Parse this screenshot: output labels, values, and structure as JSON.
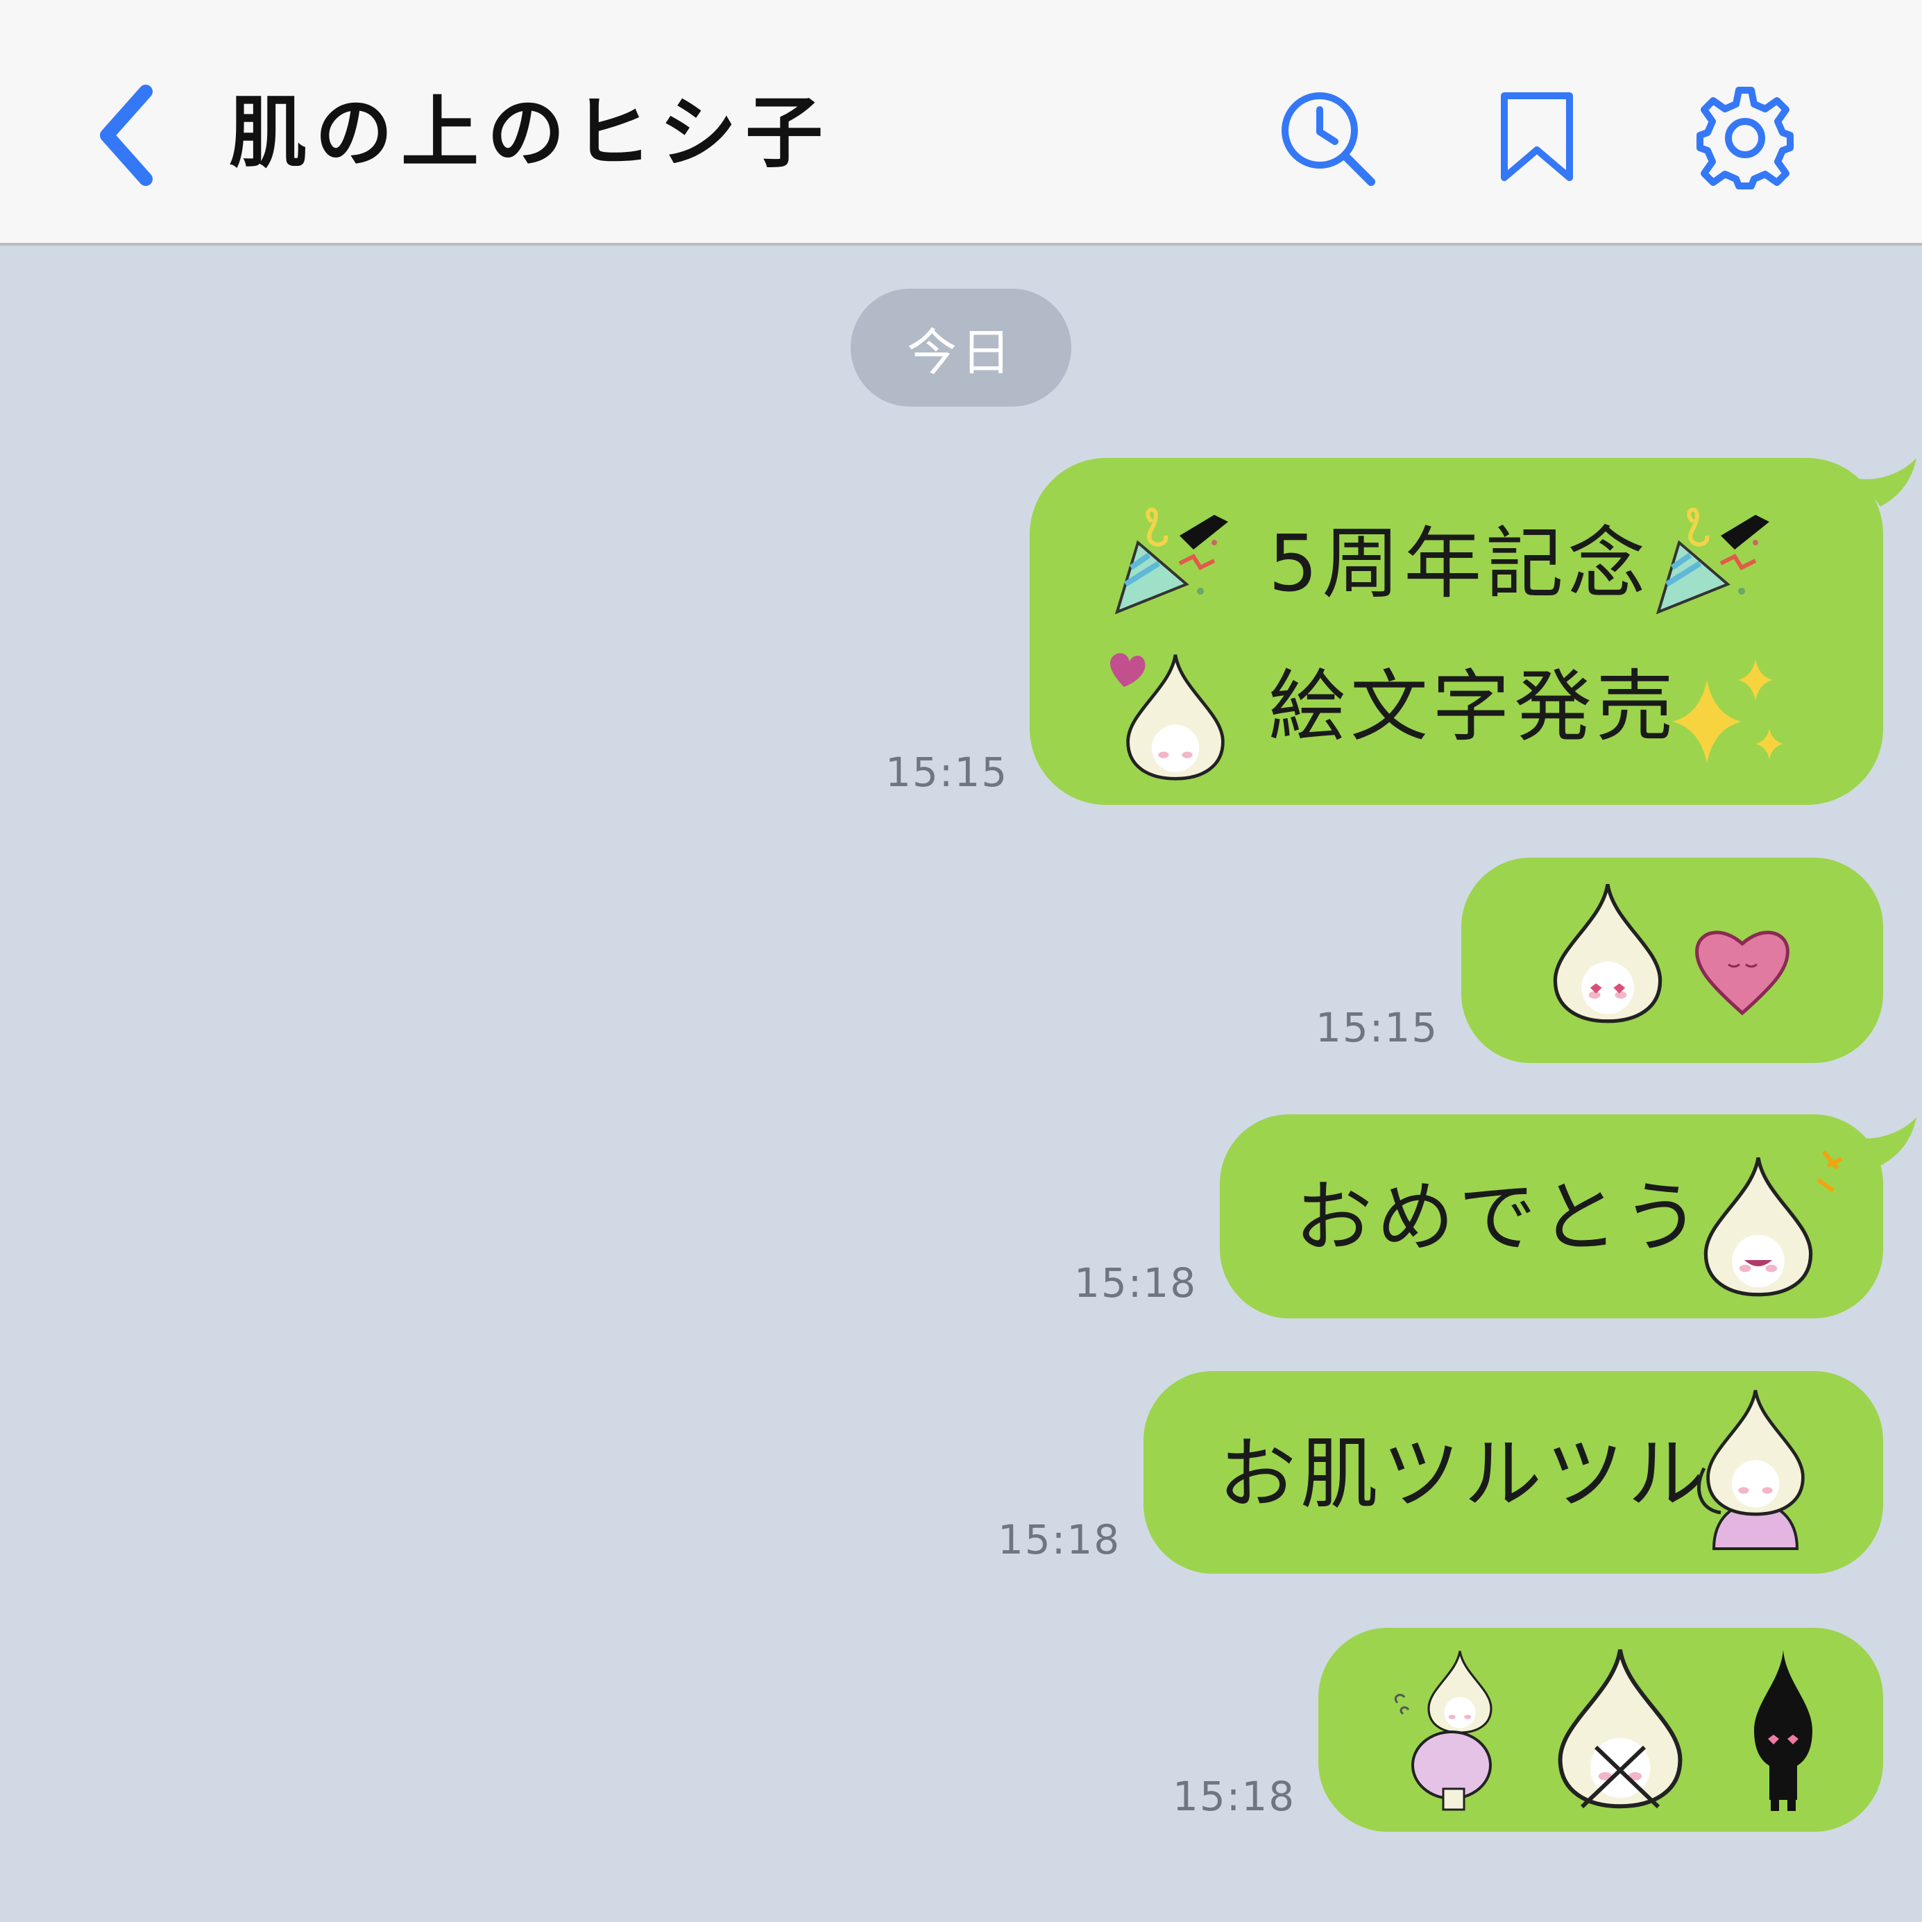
{
  "header": {
    "title": "肌の上のヒシ子",
    "back_icon": "chevron-left-icon",
    "search_icon": "search-history-icon",
    "bookmark_icon": "bookmark-icon",
    "settings_icon": "gear-icon"
  },
  "date_separator": "今日",
  "colors": {
    "accent": "#3478f6",
    "bubble": "#9cd44d",
    "background": "#d1d9e4"
  },
  "messages": [
    {
      "time": "15:15",
      "lines": [
        "5周年記念",
        "絵文字発売"
      ],
      "emojis": [
        "party-popper-emoji",
        "party-popper-emoji",
        "heart-drop-character-emoji",
        "sparkles-emoji"
      ]
    },
    {
      "time": "15:15",
      "lines": [],
      "emojis": [
        "heart-eyes-drop-character-emoji",
        "pink-heart-emoji"
      ]
    },
    {
      "time": "15:18",
      "lines": [
        "おめでとう"
      ],
      "emojis": [
        "laughing-drop-character-emoji"
      ]
    },
    {
      "time": "15:18",
      "lines": [
        "お肌ツルツル"
      ],
      "emojis": [
        "drop-character-touching-cheek-emoji"
      ]
    },
    {
      "time": "15:18",
      "lines": [],
      "emojis": [
        "pregnant-drop-character-emoji",
        "drop-character-crossed-arms-emoji",
        "black-drop-character-emoji"
      ]
    }
  ]
}
